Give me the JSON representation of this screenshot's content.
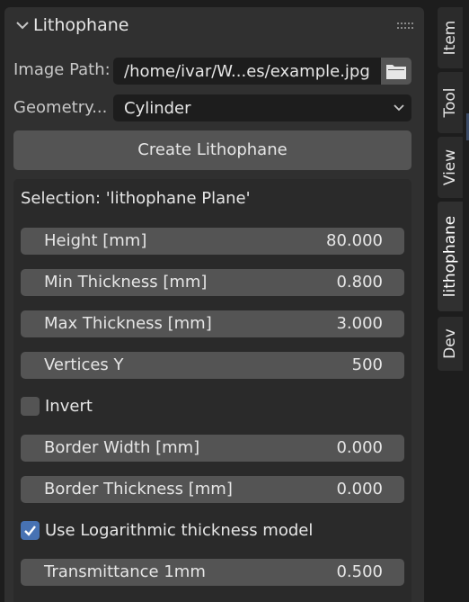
{
  "panel": {
    "title": "Lithophane",
    "image_path_label": "Image Path:",
    "image_path_value": "/home/ivar/W...es/example.jpg",
    "geometry_label": "Geometry...",
    "geometry_value": "Cylinder",
    "create_button": "Create Lithophane"
  },
  "selection": {
    "label": "Selection: 'lithophane Plane'",
    "fields": [
      {
        "label": "Height [mm]",
        "value": "80.000"
      },
      {
        "label": "Min Thickness [mm]",
        "value": "0.800"
      },
      {
        "label": "Max Thickness [mm]",
        "value": "3.000"
      },
      {
        "label": "Vertices Y",
        "value": "500"
      },
      {
        "label": "Border Width [mm]",
        "value": "0.000"
      },
      {
        "label": "Border Thickness [mm]",
        "value": "0.000"
      },
      {
        "label": "Transmittance 1mm",
        "value": "0.500"
      }
    ],
    "invert": {
      "label": "Invert",
      "checked": false
    },
    "log_model": {
      "label": "Use Logarithmic thickness model",
      "checked": true
    }
  },
  "tabs": [
    {
      "label": "Item",
      "active": false
    },
    {
      "label": "Tool",
      "active": false
    },
    {
      "label": "View",
      "active": false
    },
    {
      "label": "lithophane",
      "active": true
    },
    {
      "label": "Dev",
      "active": false
    }
  ],
  "colors": {
    "panel_bg": "#303030",
    "field_bg": "#1d1d1d",
    "widget_bg": "#545454",
    "accent": "#4772b3"
  }
}
